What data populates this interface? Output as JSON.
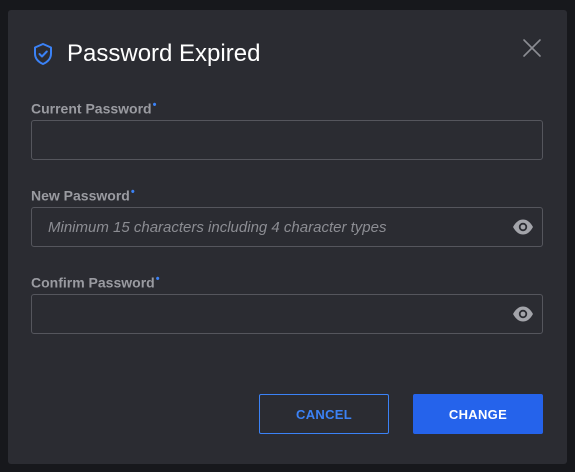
{
  "dialog": {
    "title": "Password Expired",
    "header_icon": "shield-check-icon",
    "close_icon": "close-icon"
  },
  "fields": {
    "current": {
      "label": "Current Password",
      "required_mark": "•",
      "value": "",
      "placeholder": ""
    },
    "new": {
      "label": "New Password",
      "required_mark": "•",
      "value": "",
      "placeholder": "Minimum 15 characters including 4 character types",
      "toggle_icon": "eye-icon"
    },
    "confirm": {
      "label": "Confirm Password",
      "required_mark": "•",
      "value": "",
      "placeholder": "",
      "toggle_icon": "eye-icon"
    }
  },
  "buttons": {
    "cancel_label": "CANCEL",
    "change_label": "CHANGE"
  },
  "colors": {
    "accent": "#3b82f6",
    "primary_button": "#2563eb",
    "modal_bg": "#2b2c32"
  }
}
